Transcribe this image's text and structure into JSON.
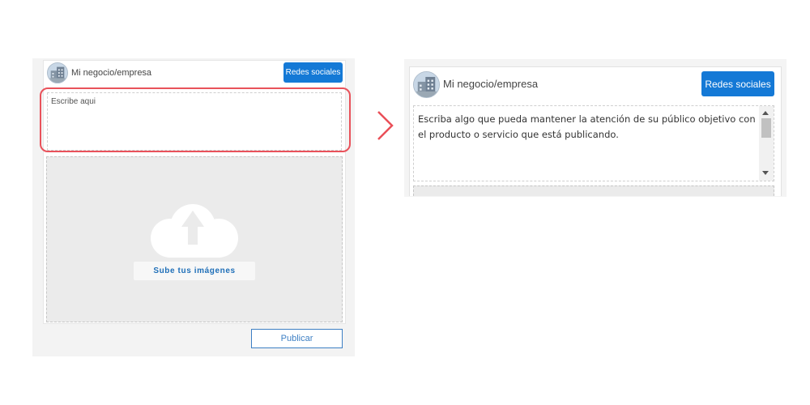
{
  "colors": {
    "primary_button": "#1479d6",
    "highlight_border": "#e9525b",
    "upload_text": "#1f6fb8",
    "publish_border": "#3d7fc4"
  },
  "left_panel": {
    "avatar_icon": "building-avatar-icon",
    "profile_name": "Mi negocio/empresa",
    "social_button_label": "Redes sociales",
    "textarea_placeholder": "Escribe aqui",
    "upload_icon": "cloud-upload-icon",
    "upload_button_label": "Sube tus imágenes",
    "publish_button_label": "Publicar"
  },
  "arrow_icon": "chevron-right-icon",
  "right_panel": {
    "avatar_icon": "building-avatar-icon",
    "profile_name": "Mi negocio/empresa",
    "social_button_label": "Redes sociales",
    "textarea_value": "Escriba algo que pueda mantener la atención de su público objetivo con el producto o servicio que está publicando."
  }
}
